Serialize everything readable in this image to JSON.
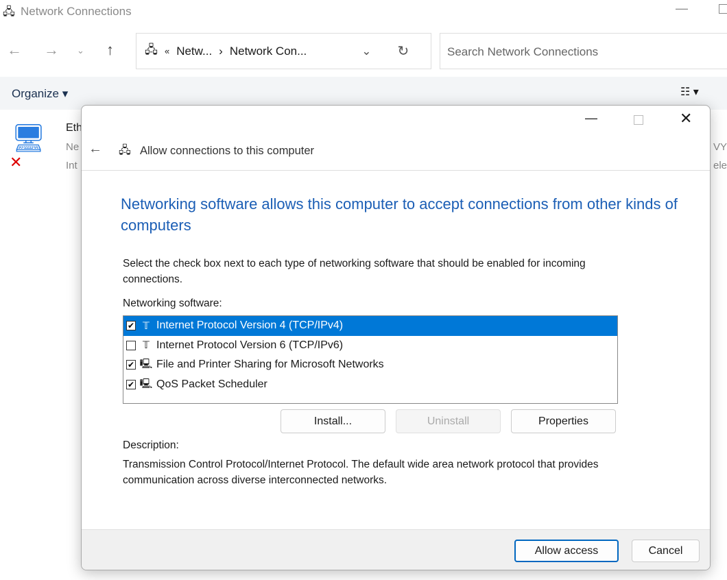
{
  "window": {
    "title": "Network Connections"
  },
  "address": {
    "crumbs": [
      "Netw...",
      "Network Con..."
    ],
    "overflow": "«"
  },
  "search": {
    "placeholder": "Search Network Connections"
  },
  "toolbar": {
    "organize": "Organize"
  },
  "background_item": {
    "name_fragment": "Eth",
    "line2_fragment": "Ne",
    "line3_fragment": "Int",
    "right_fragment1": "VY",
    "right_fragment2": "eles"
  },
  "dialog": {
    "title": "Allow connections to this computer",
    "heading": "Networking software allows this computer to accept connections from other kinds of computers",
    "instruction": "Select the check box next to each type of networking software that should be enabled for incoming connections.",
    "list_label": "Networking software:",
    "items": [
      {
        "label": "Internet Protocol Version 4 (TCP/IPv4)",
        "checked": true,
        "selected": true,
        "icon": "protocol-icon"
      },
      {
        "label": "Internet Protocol Version 6 (TCP/IPv6)",
        "checked": false,
        "selected": false,
        "icon": "protocol-icon"
      },
      {
        "label": "File and Printer Sharing for Microsoft Networks",
        "checked": true,
        "selected": false,
        "icon": "computer-icon"
      },
      {
        "label": "QoS Packet Scheduler",
        "checked": true,
        "selected": false,
        "icon": "computer-icon"
      }
    ],
    "buttons": {
      "install": "Install...",
      "uninstall": "Uninstall",
      "properties": "Properties",
      "allow": "Allow access",
      "cancel": "Cancel"
    },
    "description_label": "Description:",
    "description": "Transmission Control Protocol/Internet Protocol. The default wide area network protocol that provides communication across diverse interconnected networks.",
    "accent": "#0078d7"
  }
}
